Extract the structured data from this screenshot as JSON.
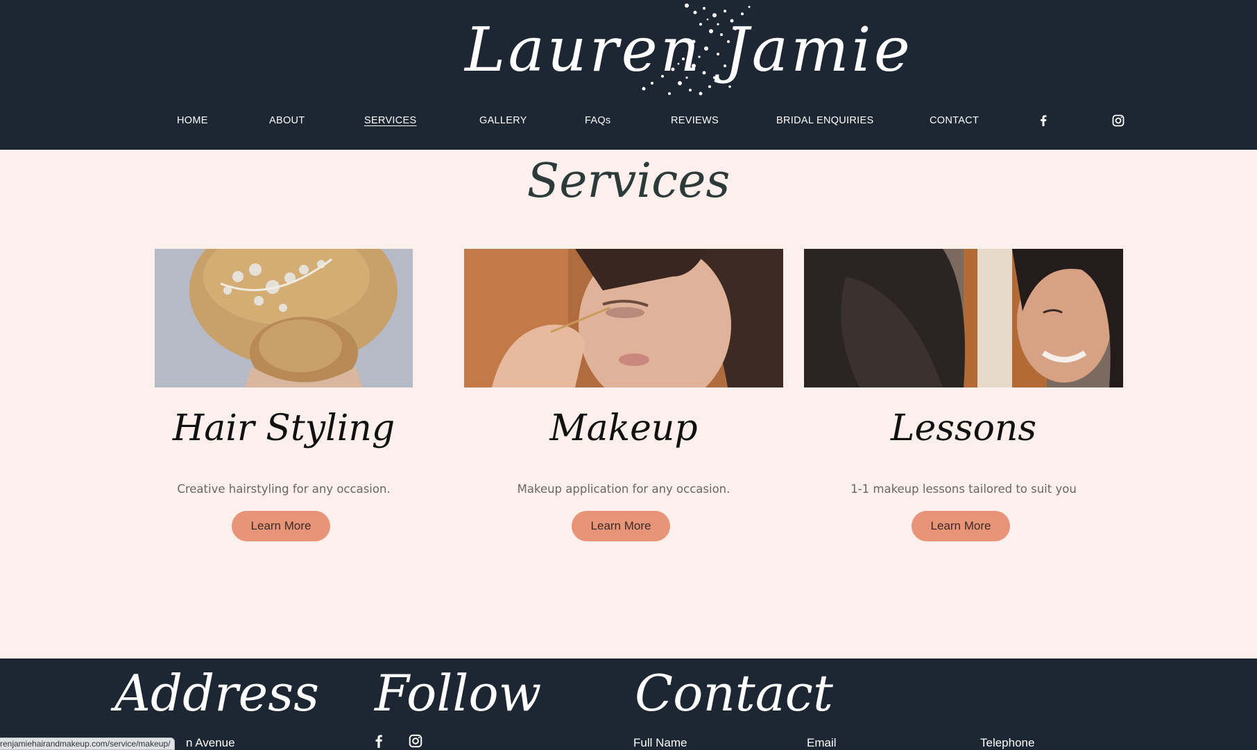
{
  "header": {
    "logo_text": "Lauren Jamie",
    "nav": [
      {
        "label": "HOME"
      },
      {
        "label": "ABOUT"
      },
      {
        "label": "SERVICES",
        "active": true
      },
      {
        "label": "GALLERY"
      },
      {
        "label": "FAQs"
      },
      {
        "label": "REVIEWS"
      },
      {
        "label": "BRIDAL ENQUIRIES"
      },
      {
        "label": "CONTACT"
      }
    ],
    "social_icons": [
      "facebook-icon",
      "instagram-icon"
    ]
  },
  "main": {
    "title": "Services",
    "cards": [
      {
        "title": "Hair Styling",
        "description": "Creative hairstyling for any occasion.",
        "button": "Learn More"
      },
      {
        "title": "Makeup",
        "description": "Makeup application for any occasion.",
        "button": "Learn More"
      },
      {
        "title": "Lessons",
        "description": "1-1 makeup lessons tailored to suit you",
        "button": "Learn More"
      }
    ]
  },
  "footer": {
    "address_title": "Address",
    "address_text": "n Avenue",
    "follow_title": "Follow",
    "contact_title": "Contact",
    "contact_fields": [
      "Full Name",
      "Email",
      "Telephone"
    ]
  },
  "status_bar": {
    "url": "renjamiehairandmakeup.com/service/makeup/"
  },
  "colors": {
    "header_bg": "#1c2733",
    "page_bg": "#fcf0ec",
    "button_bg": "#e89478"
  }
}
